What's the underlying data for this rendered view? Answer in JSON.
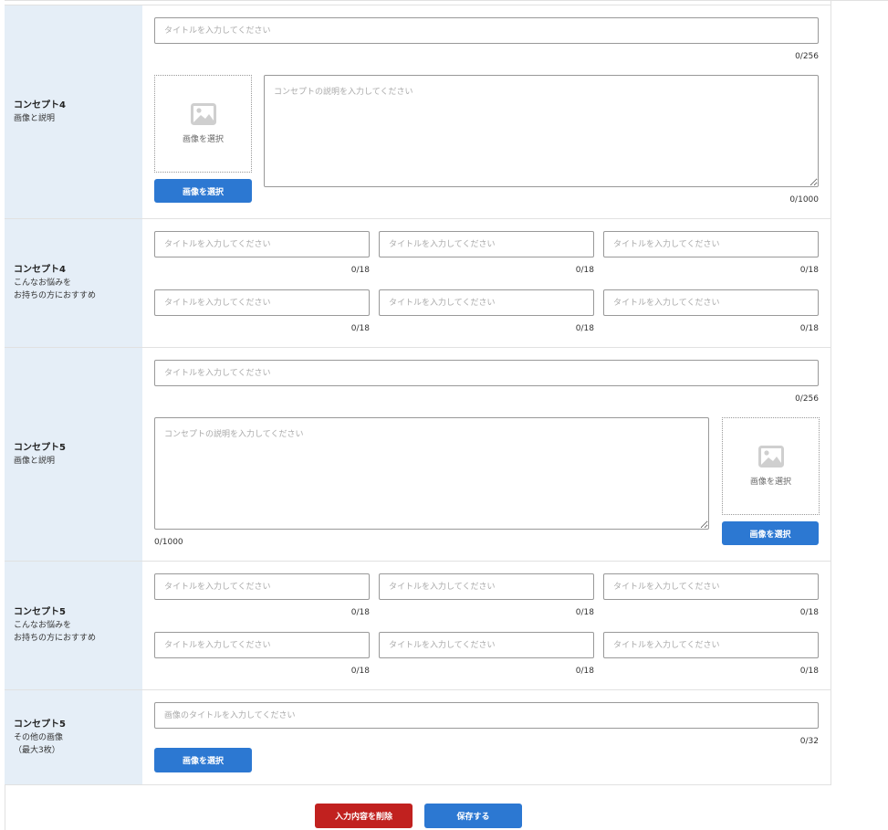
{
  "placeholders": {
    "title": "タイトルを入力してください",
    "description": "コンセプトの説明を入力してください",
    "image_title": "画像のタイトルを入力してください"
  },
  "image_box_label": "画像を選択",
  "select_image_button": "画像を選択",
  "sections": [
    {
      "title": "コンセプト4",
      "subtitle": "画像と説明",
      "title_count": "0/256",
      "desc_count": "0/1000"
    },
    {
      "title": "コンセプト4",
      "subtitle": "こんなお悩みを\nお持ちの方におすすめ",
      "counts": [
        "0/18",
        "0/18",
        "0/18",
        "0/18",
        "0/18",
        "0/18"
      ]
    },
    {
      "title": "コンセプト5",
      "subtitle": "画像と説明",
      "title_count": "0/256",
      "desc_count": "0/1000"
    },
    {
      "title": "コンセプト5",
      "subtitle": "こんなお悩みを\nお持ちの方におすすめ",
      "counts": [
        "0/18",
        "0/18",
        "0/18",
        "0/18",
        "0/18",
        "0/18"
      ]
    },
    {
      "title": "コンセプト5",
      "subtitle": "その他の画像\n（最大3枚）",
      "image_title_count": "0/32"
    }
  ],
  "footer": {
    "delete_label": "入力内容を削除",
    "save_label": "保存する"
  },
  "colors": {
    "primary": "#2c78d2",
    "danger": "#c1211f",
    "label_bg": "#e5eef7"
  }
}
